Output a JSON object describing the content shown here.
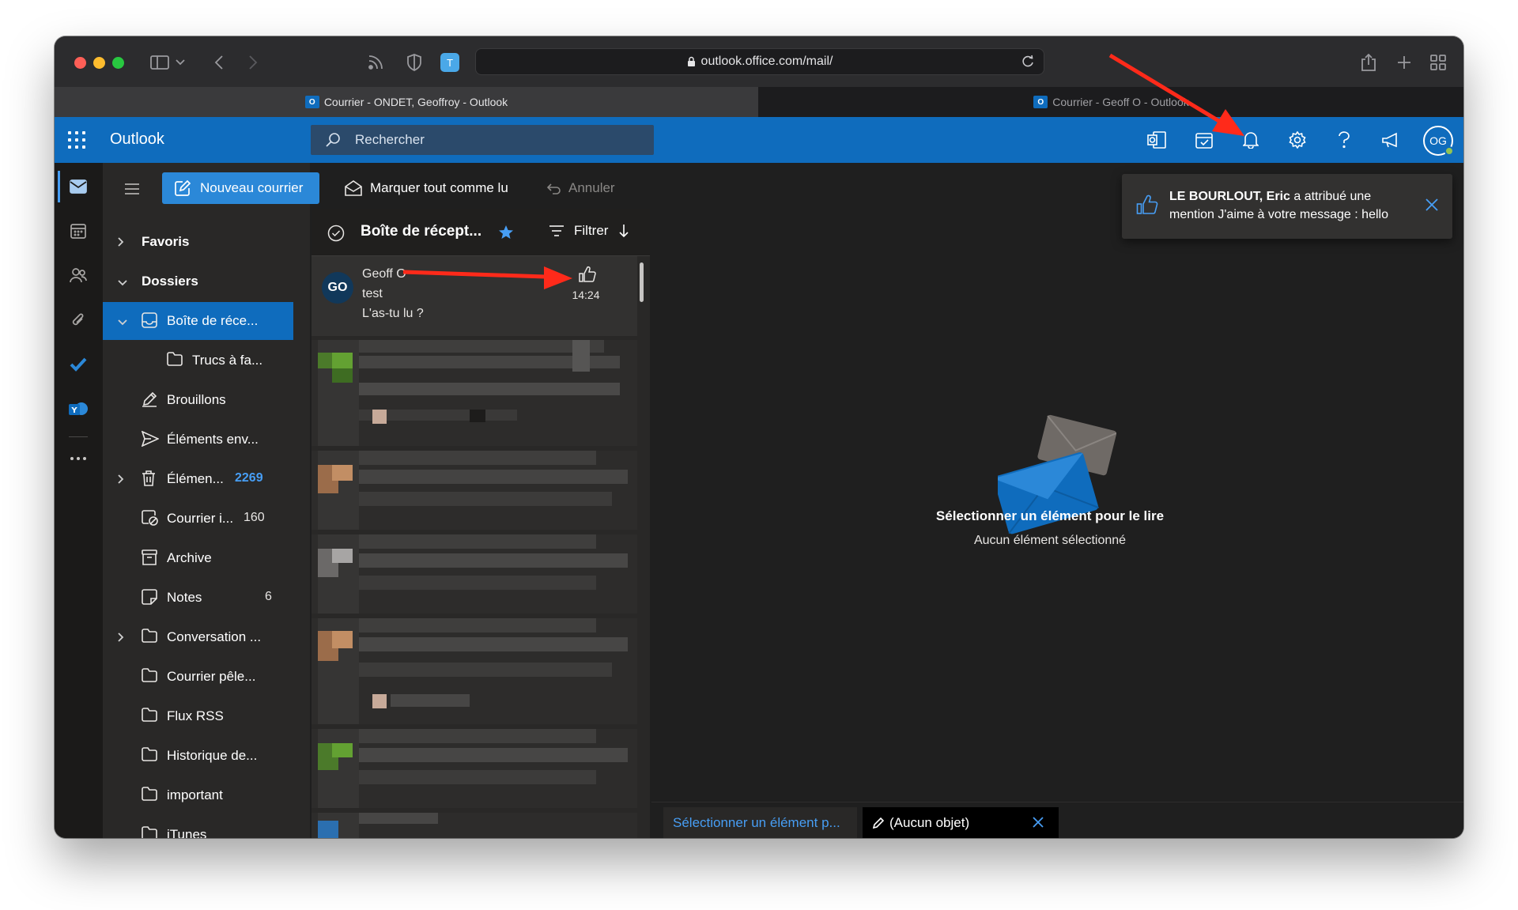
{
  "browser": {
    "url": "outlook.office.com/mail/",
    "tabs": [
      {
        "label": "Courrier - ONDET, Geoffroy - Outlook",
        "active": true
      },
      {
        "label": "Courrier - Geoff O - Outlook",
        "active": false
      }
    ]
  },
  "header": {
    "brand": "Outlook",
    "search_placeholder": "Rechercher",
    "icons": [
      "office-icon",
      "todo-icon",
      "bell-icon",
      "gear-icon",
      "help-icon",
      "megaphone-icon"
    ],
    "avatar_initials": "OG"
  },
  "commands": {
    "new_mail": "Nouveau courrier",
    "mark_all_read": "Marquer tout comme lu",
    "undo": "Annuler"
  },
  "folders": {
    "favorites": "Favoris",
    "dossiers": "Dossiers",
    "items": [
      {
        "label": "Boîte de réce...",
        "count": "",
        "selected": true
      },
      {
        "label": "Trucs à fa...",
        "count": ""
      },
      {
        "label": "Brouillons",
        "count": ""
      },
      {
        "label": "Éléments env...",
        "count": ""
      },
      {
        "label": "Élémen...",
        "count": "2269"
      },
      {
        "label": "Courrier i...",
        "count": "160"
      },
      {
        "label": "Archive",
        "count": ""
      },
      {
        "label": "Notes",
        "count": "6"
      },
      {
        "label": "Conversation ...",
        "count": ""
      },
      {
        "label": "Courrier pêle...",
        "count": ""
      },
      {
        "label": "Flux RSS",
        "count": ""
      },
      {
        "label": "Historique de...",
        "count": ""
      },
      {
        "label": "important",
        "count": ""
      },
      {
        "label": "iTunes",
        "count": ""
      }
    ]
  },
  "message_list": {
    "title": "Boîte de récept...",
    "filter": "Filtrer",
    "messages": [
      {
        "initials": "GO",
        "from": "Geoff O",
        "subject": "test",
        "preview": "L'as-tu lu ?",
        "time": "14:24"
      }
    ]
  },
  "reading_pane": {
    "title": "Sélectionner un élément pour le lire",
    "subtitle": "Aucun élément sélectionné"
  },
  "notification": {
    "name": "LE BOURLOUT, Eric",
    "text": " a attribué une mention J'aime à votre message : hello"
  },
  "bottom_tabs": {
    "tab1": "Sélectionner un élément p...",
    "tab2": "(Aucun objet)"
  },
  "colors": {
    "accent": "#0f6cbd",
    "arrow": "#ff2a1a"
  }
}
